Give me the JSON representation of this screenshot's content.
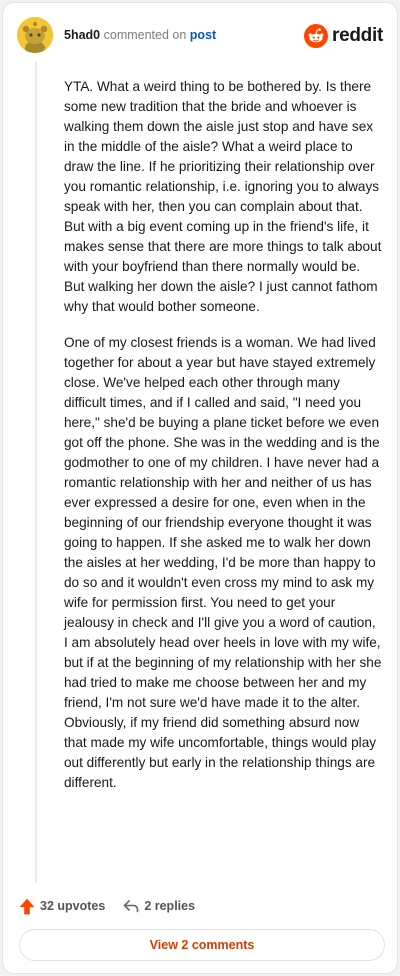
{
  "header": {
    "author": "5had0",
    "commented_on": "commented on",
    "post_link": "post",
    "brand": "reddit"
  },
  "comment": {
    "paragraphs": [
      "YTA. What a weird thing to be bothered by. Is there some new tradition that the bride and whoever is walking them down the aisle just stop and have sex in the middle of the aisle? What a weird place to draw the line. If he prioritizing their relationship over you romantic relationship, i.e. ignoring you to always speak with her, then you can complain about that. But with a big event coming up in the friend's life, it makes sense that there are more things to talk about with your boyfriend than there normally would be. But walking her down the aisle? I just cannot fathom why that would bother someone.",
      "One of my closest friends is a woman. We had lived together for about a year but have stayed extremely close. We've helped each other through many difficult times, and if I called and said, \"I need you here,\" she'd be buying a plane ticket before we even got off the phone. She was in the wedding and is the godmother to one of my children. I have never had a romantic relationship with her and neither of us has ever expressed a desire for one, even when in the beginning of our friendship everyone thought it was going to happen. If she asked me to walk her down the aisles at her wedding, I'd be more than happy to do so and it wouldn't even cross my mind to ask my wife for permission first. You need to get your jealousy in check and I'll give you a word of caution, I am absolutely head over heels in love with my wife, but if at the beginning of my relationship with her she had tried to make me choose between her and my friend, I'm not sure we'd have made it to the alter. Obviously, if my friend did something absurd now that made my wife uncomfortable, things would play out differently but early in the relationship things are different."
    ]
  },
  "actions": {
    "upvotes": "32 upvotes",
    "replies": "2 replies"
  },
  "footer": {
    "view_comments": "View 2 comments"
  },
  "colors": {
    "brand_orange": "#ff4500",
    "link_blue": "#0a58c8",
    "button_text": "#d93a00"
  },
  "icons": {
    "avatar": "snoo-avatar-icon",
    "brand": "reddit-logo-icon",
    "upvote": "upvote-arrow-icon",
    "reply": "reply-arrow-icon"
  }
}
